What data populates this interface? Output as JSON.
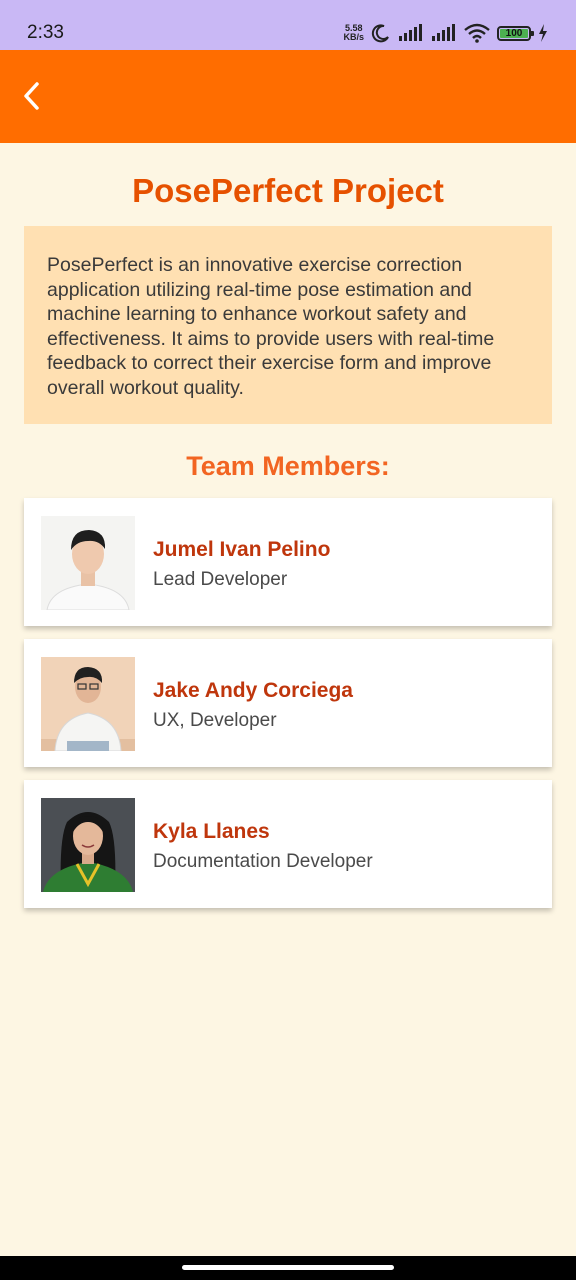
{
  "status_bar": {
    "time": "2:33",
    "network_speed_value": "5.58",
    "network_speed_unit": "KB/s",
    "battery_level": "100",
    "icons": [
      "moon-icon",
      "signal-icon",
      "signal-icon",
      "wifi-icon",
      "battery-icon",
      "charging-icon"
    ]
  },
  "app_bar": {
    "back_icon": "chevron-left-icon",
    "color": "#FF6D00"
  },
  "project": {
    "title": "PosePerfect Project",
    "description": "PosePerfect is an innovative exercise correction application utilizing real-time pose estimation and machine learning to enhance workout safety and effectiveness. It aims to provide users with real-time feedback to correct their exercise form and improve overall workout quality."
  },
  "team": {
    "heading": "Team Members:",
    "members": [
      {
        "name": "Jumel Ivan Pelino",
        "role": "Lead Developer"
      },
      {
        "name": "Jake Andy Corciega",
        "role": "UX, Developer"
      },
      {
        "name": "Kyla Llanes",
        "role": "Documentation Developer"
      }
    ]
  },
  "colors": {
    "background": "#FDF6E3",
    "accent": "#E65100",
    "description_box": "#FFE0B2",
    "member_name": "#BF360C"
  }
}
